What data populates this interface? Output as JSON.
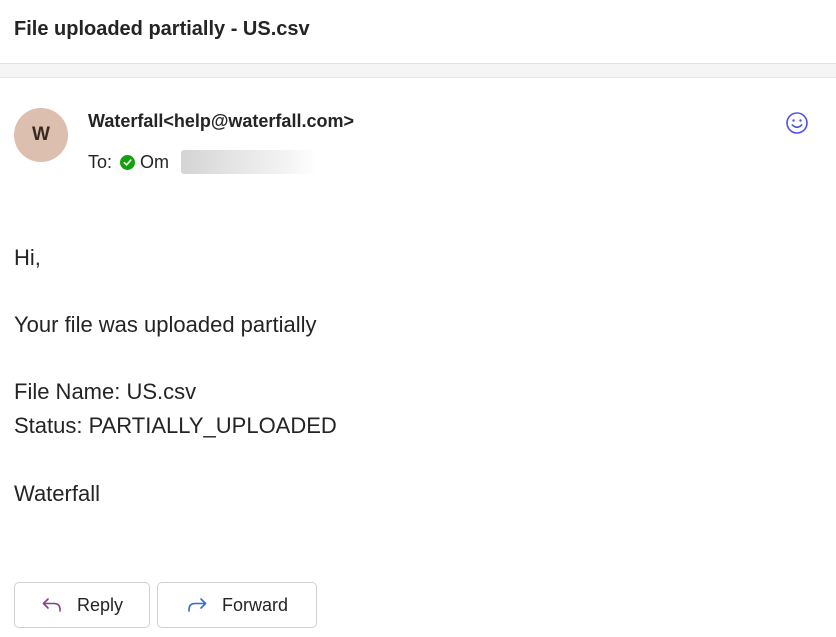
{
  "email": {
    "subject": "File uploaded partially - US.csv",
    "avatar_initial": "W",
    "sender": "Waterfall<help@waterfall.com>",
    "to_label": "To:",
    "recipient_visible": "Om",
    "body": {
      "greeting": "Hi,",
      "message": "Your file was uploaded partially",
      "file_name_line": "File Name: US.csv",
      "status_line": "Status: PARTIALLY_UPLOADED",
      "signature": "Waterfall"
    }
  },
  "actions": {
    "reply_label": "Reply",
    "forward_label": "Forward"
  },
  "icons": {
    "reaction": "smiley-icon",
    "presence": "available-check-icon",
    "reply": "reply-arrow-icon",
    "forward": "forward-arrow-icon"
  },
  "colors": {
    "avatar_bg": "#dcbfae",
    "presence_green": "#13a10e",
    "accent_blue": "#4f52e6",
    "reply_icon": "#8a3f8f",
    "forward_icon": "#2f6fd0"
  }
}
